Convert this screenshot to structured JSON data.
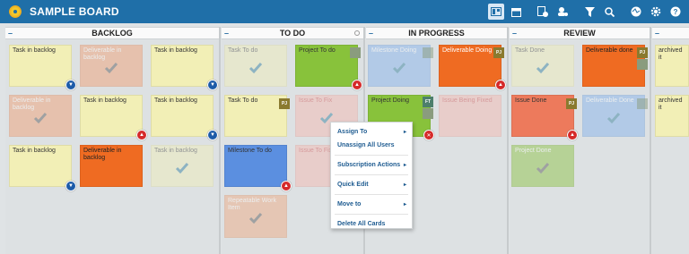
{
  "app": {
    "title": "SAMPLE BOARD"
  },
  "colors": {
    "topbar": "#1f6fa8",
    "accent": "#1f5c91"
  },
  "toolbar": {
    "icons": [
      "board-view-icon",
      "calendar-icon",
      "add-card-icon",
      "add-user-icon",
      "filter-icon",
      "search-icon",
      "activity-icon",
      "settings-icon",
      "help-icon"
    ]
  },
  "columns": {
    "backlog": "BACKLOG",
    "todo": "TO DO",
    "inprogress": "IN PROGRESS",
    "review": "REVIEW"
  },
  "cards": {
    "b1": "Task in backlog",
    "b2": "Deliverable in backlog",
    "b3": "Task in backlog",
    "b4": "Deliverable in backlog",
    "b5": "Task in backlog",
    "b6": "Task in backlog",
    "b7": "Task in backlog",
    "b8": "Deliverable in backlog",
    "b9": "Task in backlog",
    "t1": "Task To do",
    "t2": "Project To do",
    "t3": "Task To do",
    "t4": "Issue To Fix",
    "t5": "Milestone To do",
    "t6": "Issue To Fix",
    "t7": "Repeatable Work Item",
    "p1": "Milestone Doing",
    "p2": "Deliverable Doing",
    "p3": "Project Doing",
    "p4": "Issue Being Fixed",
    "r1": "Task Done",
    "r2": "Deliverable done",
    "r3": "Issue Done",
    "r4": "Deliverable Done",
    "r5": "Project Done",
    "a1": "archived it",
    "a2": "archived it"
  },
  "avatars": {
    "pj": "PJ",
    "ft": "FT"
  },
  "menu": {
    "assign_to": "Assign To",
    "unassign_all": "Unassign All Users",
    "subscription": "Subscription Actions",
    "quick_edit": "Quick Edit",
    "move_to": "Move to",
    "delete_all": "Delete All Cards"
  }
}
